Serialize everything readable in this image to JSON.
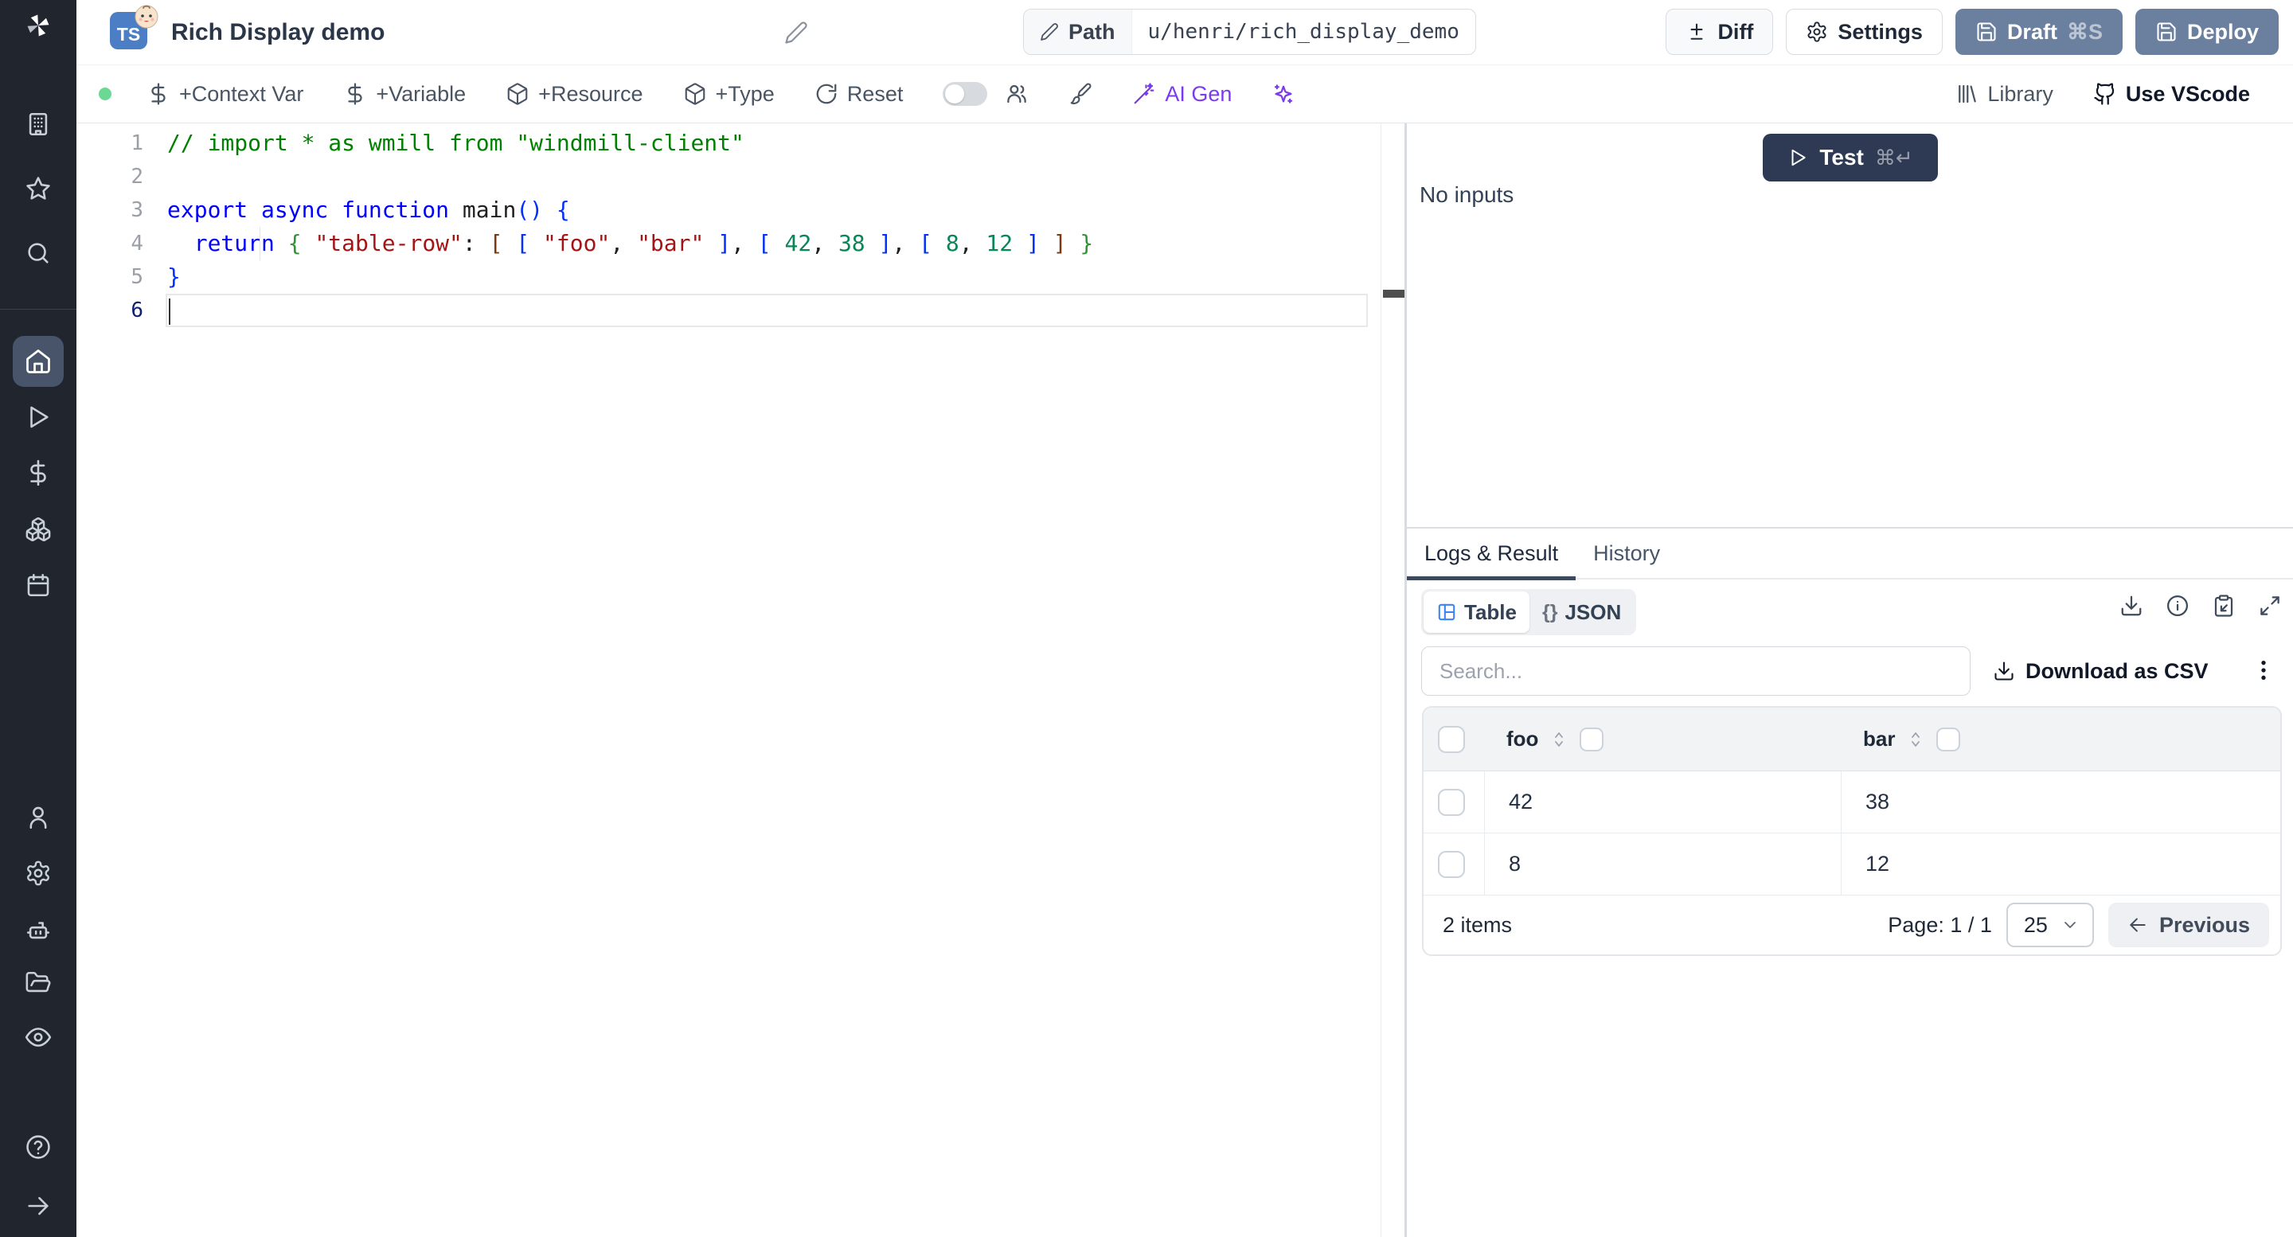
{
  "app": {
    "title": "Rich Display demo"
  },
  "colors": {
    "sidebar_bg": "#21262e",
    "active_nav_bg": "#475469",
    "accent_slate": "#6b7f9f",
    "test_button": "#2e3a54",
    "ai_purple": "#7c3aed",
    "status_green": "#6bd993",
    "table_icon_blue": "#3b82f6",
    "ts_badge_blue": "#4b7ec5"
  },
  "sidebar": {
    "icons": [
      "windmill-logo",
      "building",
      "star",
      "search",
      "home",
      "play",
      "dollar",
      "boxes",
      "calendar",
      "user",
      "settings",
      "worker",
      "folder-open",
      "eye",
      "help",
      "arrow-right"
    ],
    "active_item": "home"
  },
  "topbar": {
    "lang_badge": "TS",
    "path_label": "Path",
    "path_value": "u/henri/rich_display_demo",
    "diff_label": "Diff",
    "settings_label": "Settings",
    "draft_label": "Draft",
    "draft_shortcut": "⌘S",
    "deploy_label": "Deploy"
  },
  "toolbar": {
    "context_var_label": "+Context Var",
    "variable_label": "+Variable",
    "resource_label": "+Resource",
    "type_label": "+Type",
    "reset_label": "Reset",
    "ai_gen_label": "AI Gen",
    "library_label": "Library",
    "use_vscode_label": "Use VScode"
  },
  "editor": {
    "language": "typescript",
    "lines": [
      {
        "no": "1",
        "active": false,
        "tokens": [
          {
            "t": "// import * as wmill from \"windmill-client\"",
            "c": "comment"
          }
        ]
      },
      {
        "no": "2",
        "active": false,
        "tokens": []
      },
      {
        "no": "3",
        "active": false,
        "tokens": [
          {
            "t": "export async function",
            "c": "kw"
          },
          {
            "t": " main",
            "c": "fn"
          },
          {
            "t": "(",
            "c": "b1"
          },
          {
            "t": ")",
            "c": "b1"
          },
          {
            "t": " ",
            "c": "pl"
          },
          {
            "t": "{",
            "c": "b1"
          }
        ]
      },
      {
        "no": "4",
        "active": false,
        "tokens": [
          {
            "t": "  ",
            "c": "pl"
          },
          {
            "t": "return",
            "c": "kw"
          },
          {
            "t": " ",
            "c": "pl"
          },
          {
            "t": "{",
            "c": "b2"
          },
          {
            "t": " ",
            "c": "pl"
          },
          {
            "t": "\"table-row\"",
            "c": "str"
          },
          {
            "t": ": ",
            "c": "pl"
          },
          {
            "t": "[",
            "c": "b3"
          },
          {
            "t": " ",
            "c": "pl"
          },
          {
            "t": "[",
            "c": "b1"
          },
          {
            "t": " ",
            "c": "pl"
          },
          {
            "t": "\"foo\"",
            "c": "str"
          },
          {
            "t": ", ",
            "c": "pl"
          },
          {
            "t": "\"bar\"",
            "c": "str"
          },
          {
            "t": " ",
            "c": "pl"
          },
          {
            "t": "]",
            "c": "b1"
          },
          {
            "t": ", ",
            "c": "pl"
          },
          {
            "t": "[",
            "c": "b1"
          },
          {
            "t": " ",
            "c": "pl"
          },
          {
            "t": "42",
            "c": "num"
          },
          {
            "t": ", ",
            "c": "pl"
          },
          {
            "t": "38",
            "c": "num"
          },
          {
            "t": " ",
            "c": "pl"
          },
          {
            "t": "]",
            "c": "b1"
          },
          {
            "t": ", ",
            "c": "pl"
          },
          {
            "t": "[",
            "c": "b1"
          },
          {
            "t": " ",
            "c": "pl"
          },
          {
            "t": "8",
            "c": "num"
          },
          {
            "t": ", ",
            "c": "pl"
          },
          {
            "t": "12",
            "c": "num"
          },
          {
            "t": " ",
            "c": "pl"
          },
          {
            "t": "]",
            "c": "b1"
          },
          {
            "t": " ",
            "c": "pl"
          },
          {
            "t": "]",
            "c": "b3"
          },
          {
            "t": " ",
            "c": "pl"
          },
          {
            "t": "}",
            "c": "b2"
          }
        ]
      },
      {
        "no": "5",
        "active": false,
        "tokens": [
          {
            "t": "}",
            "c": "b1"
          }
        ]
      },
      {
        "no": "6",
        "active": true,
        "tokens": []
      }
    ]
  },
  "run": {
    "test_label": "Test",
    "test_shortcut": "⌘↵",
    "no_inputs": "No inputs"
  },
  "result": {
    "tabs": [
      {
        "label": "Logs & Result",
        "active": true
      },
      {
        "label": "History",
        "active": false
      }
    ],
    "view_table_label": "Table",
    "view_json_label": "JSON",
    "json_braces": "{}",
    "action_icons": [
      "download",
      "info",
      "clipboard-paste",
      "expand"
    ],
    "search_placeholder": "Search...",
    "download_csv_label": "Download as CSV",
    "table": {
      "columns": [
        {
          "label": "foo"
        },
        {
          "label": "bar"
        }
      ],
      "rows": [
        [
          "42",
          "38"
        ],
        [
          "8",
          "12"
        ]
      ],
      "items_count": "2 items",
      "page_info": "Page: 1 / 1",
      "page_size": "25",
      "previous_label": "Previous"
    }
  }
}
